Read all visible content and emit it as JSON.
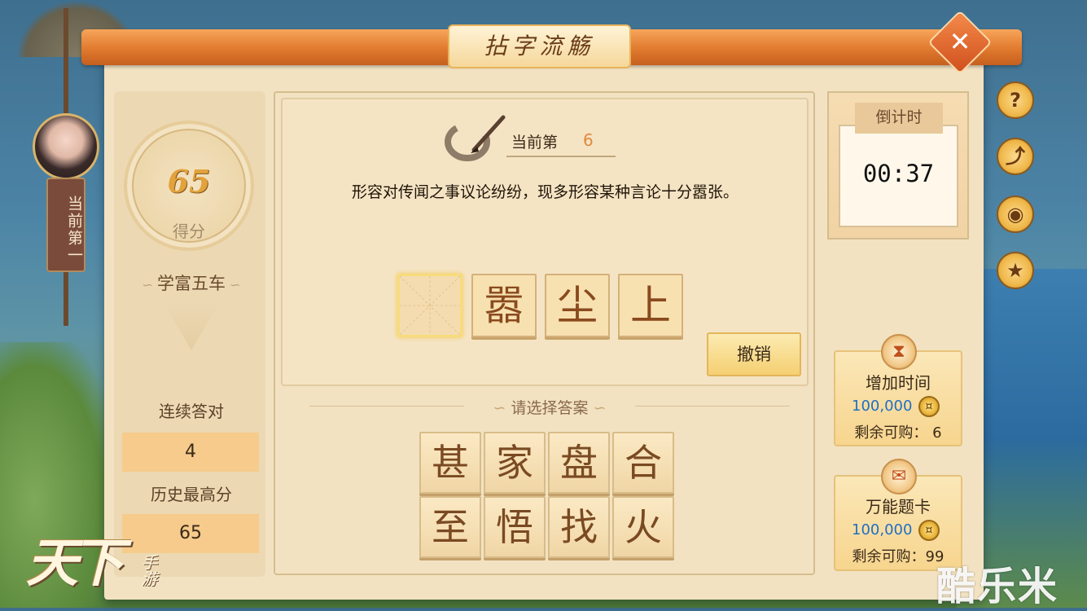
{
  "window": {
    "title": "拈字流觞",
    "close_icon": "close-icon"
  },
  "player": {
    "rank_banner": "当前第一"
  },
  "score_panel": {
    "score": "65",
    "score_label": "得分",
    "rank_title": "学富五车",
    "streak_label": "连续答对",
    "streak_value": "4",
    "best_label": "历史最高分",
    "best_value": "65"
  },
  "question": {
    "current_label": "当前第",
    "current_number": "6",
    "text": "形容对传闻之事议论纷纷，现多形容某种言论十分嚣张。",
    "slots": [
      "",
      "嚣",
      "尘",
      "上"
    ],
    "undo_label": "撤销"
  },
  "choices": {
    "prompt": "请选择答案",
    "options": [
      "甚",
      "家",
      "盘",
      "合",
      "至",
      "悟",
      "找",
      "火"
    ]
  },
  "timer": {
    "label": "倒计时",
    "value": "00:37"
  },
  "shop": [
    {
      "title": "增加时间",
      "price": "100,000",
      "remain": "剩余可购： 6",
      "icon": "hourglass-icon"
    },
    {
      "title": "万能题卡",
      "price": "100,000",
      "remain": "剩余可购：99",
      "icon": "scroll-card-icon"
    }
  ],
  "side_buttons": [
    {
      "name": "help-button",
      "glyph": "?"
    },
    {
      "name": "share-button",
      "glyph": "⤴"
    },
    {
      "name": "view-button",
      "glyph": "◉"
    },
    {
      "name": "rank-badge-button",
      "glyph": "★"
    }
  ],
  "logo": {
    "main": "天下",
    "sub": "手游"
  },
  "watermark": "酷乐米",
  "colors": {
    "accent": "#e07a2e",
    "price": "#1e6fc4",
    "score": "#e2a23c"
  }
}
